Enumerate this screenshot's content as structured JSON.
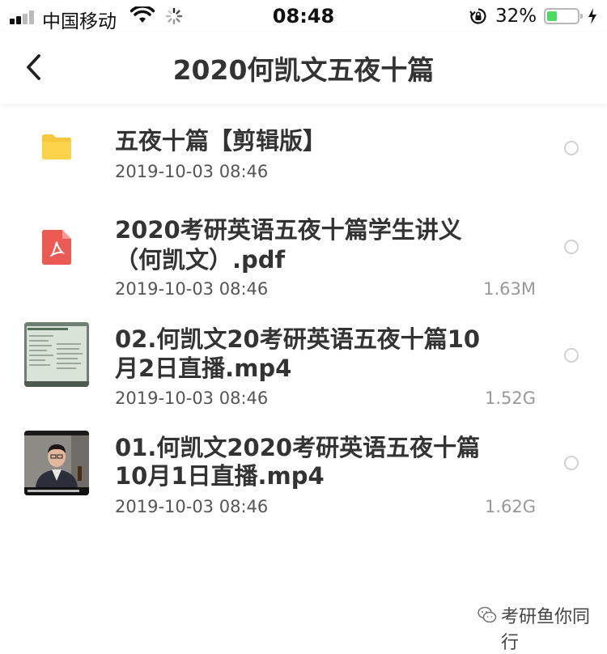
{
  "status_bar": {
    "carrier": "中国移动",
    "time": "08:48",
    "battery_percent": "32%",
    "battery_level": 0.32
  },
  "nav": {
    "back_icon": "chevron-left-icon",
    "title": "2020何凯文五夜十篇"
  },
  "files": [
    {
      "type": "folder",
      "icon": "folder-icon",
      "name_lines": [
        "五夜十篇【剪辑版】"
      ],
      "date": "2019-10-03 08:46",
      "size": ""
    },
    {
      "type": "pdf",
      "icon": "pdf-icon",
      "name_lines": [
        "2020考研英语五夜十篇学生讲义",
        "（何凯文）.pdf"
      ],
      "date": "2019-10-03 08:46",
      "size": "1.63M"
    },
    {
      "type": "video",
      "icon": "video-thumbnail-icon",
      "name_lines": [
        "02.何凯文20考研英语五夜十篇10",
        "月2日直播.mp4"
      ],
      "date": "2019-10-03 08:46",
      "size": "1.52G"
    },
    {
      "type": "video",
      "icon": "video-thumbnail-icon",
      "name_lines": [
        "01.何凯文2020考研英语五夜十篇",
        "10月1日直播.mp4"
      ],
      "date": "2019-10-03 08:46",
      "size": "1.62G"
    }
  ],
  "watermark": {
    "text": "考研鱼你同行"
  }
}
